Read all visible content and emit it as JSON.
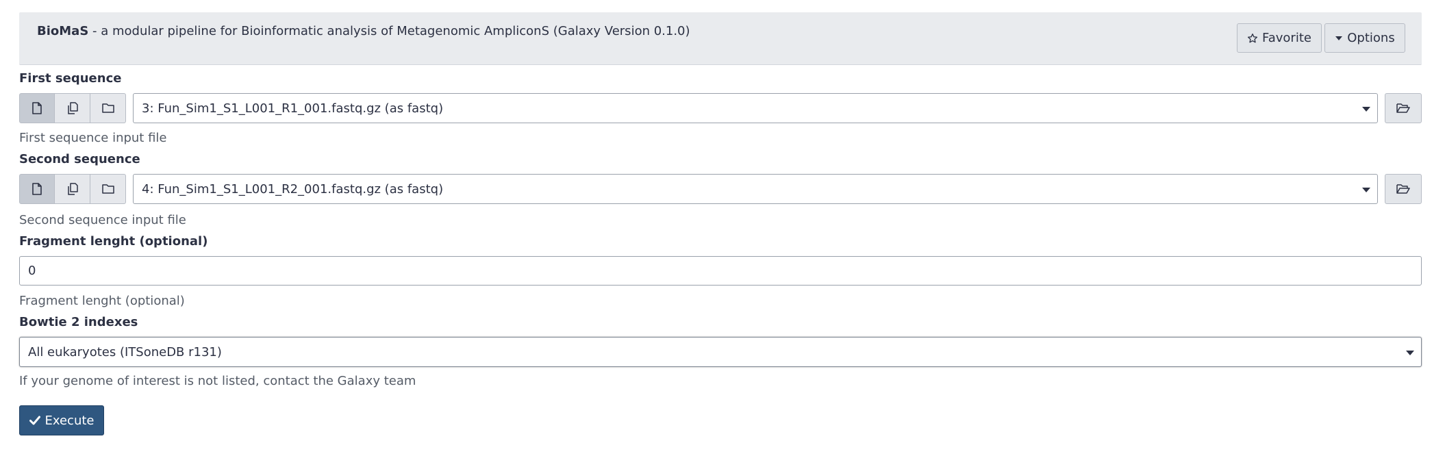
{
  "header": {
    "tool_name": "BioMaS",
    "tool_description": " - a modular pipeline for Bioinformatic analysis of Metagenomic AmpliconS (Galaxy Version 0.1.0)",
    "favorite_label": "Favorite",
    "options_label": "Options"
  },
  "first_sequence": {
    "label": "First sequence",
    "value": "3: Fun_Sim1_S1_L001_R1_001.fastq.gz (as fastq)",
    "help": "First sequence input file"
  },
  "second_sequence": {
    "label": "Second sequence",
    "value": "4: Fun_Sim1_S1_L001_R2_001.fastq.gz (as fastq)",
    "help": "Second sequence input file"
  },
  "fragment_length": {
    "label": "Fragment lenght (optional)",
    "value": "0",
    "help": "Fragment lenght (optional)"
  },
  "bowtie_indexes": {
    "label": "Bowtie 2 indexes",
    "value": "All eukaryotes (ITSoneDB r131)",
    "help": "If your genome of interest is not listed, contact the Galaxy team"
  },
  "execute_label": "Execute",
  "colors": {
    "header_bg": "#e9ebee",
    "execute_bg": "#2f5780",
    "active_toggle": "#c6cbd3"
  }
}
